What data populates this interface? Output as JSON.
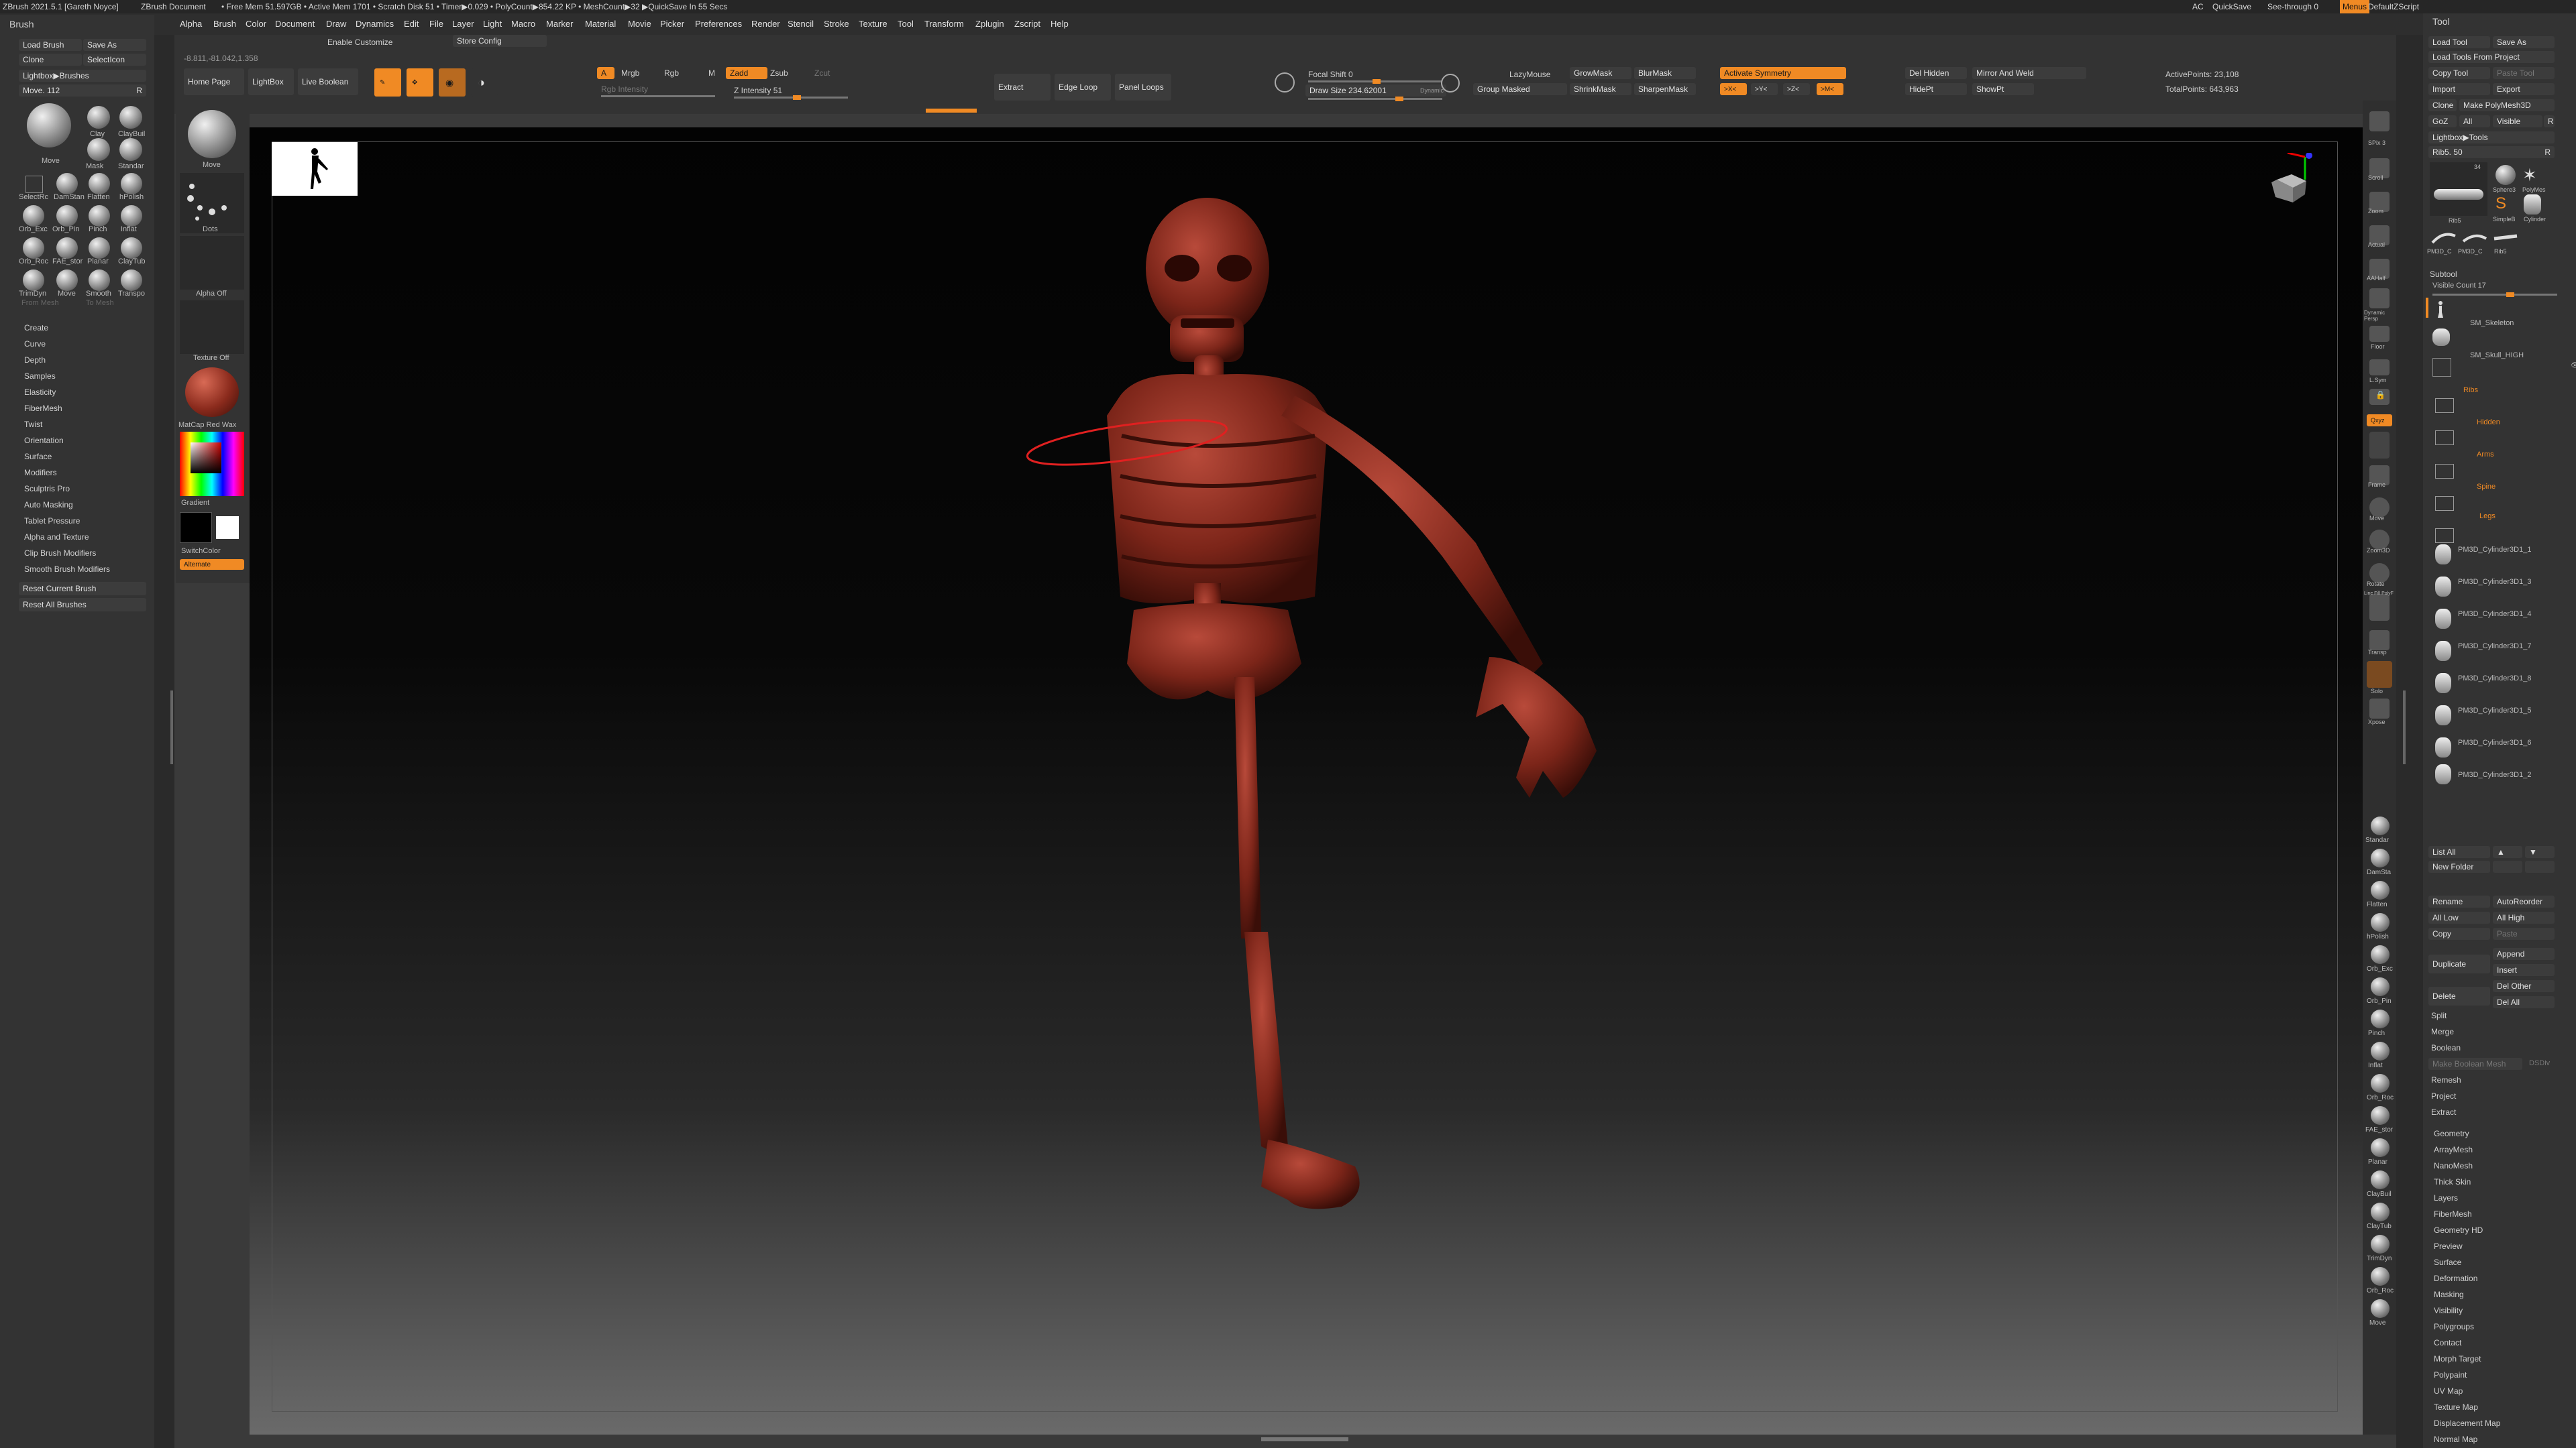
{
  "titlebar": {
    "items": [
      "ZBrush 2021.5.1 [Gareth Noyce]",
      "ZBrush Document",
      "• Free Mem 51.597GB • Active Mem 1701 • Scratch Disk 51 • Timer▶0.029 • PolyCount▶854.22 KP • MeshCount▶32 ▶QuickSave In 55 Secs"
    ],
    "right": [
      "AC",
      "QuickSave",
      "See-through 0",
      "Menus",
      "DefaultZScript"
    ]
  },
  "menu": [
    "Alpha",
    "Brush",
    "Color",
    "Document",
    "Draw",
    "Dynamics",
    "Edit",
    "File",
    "Layer",
    "Light",
    "Macro",
    "Marker",
    "Material",
    "Movie",
    "Picker",
    "Preferences",
    "Render",
    "Stencil",
    "Stroke",
    "Texture",
    "Tool",
    "Transform",
    "Zplugin",
    "Zscript",
    "Help"
  ],
  "toolbar": {
    "coords": "-8.811,-81.042,1.358",
    "enable_customize": "Enable Customize",
    "store_config": "Store Config",
    "home_page": "Home Page",
    "lightbox": "LightBox",
    "live_boolean": "Live Boolean",
    "edit": "Edit",
    "draw": "Draw",
    "a": "A",
    "mrgb": "Mrgb",
    "rgb": "Rgb",
    "m": "M",
    "zadd": "Zadd",
    "zsub": "Zsub",
    "zcut": "Zcut",
    "rgb_intensity": "Rgb Intensity",
    "z_intensity": "Z Intensity 51",
    "extract": "Extract",
    "edge_loop": "Edge Loop",
    "panel_loops": "Panel Loops",
    "focal_shift": "Focal Shift 0",
    "draw_size": "Draw Size 234.62001",
    "dynamic": "Dynamic",
    "lazymouse": "LazyMouse",
    "growmask": "GrowMask",
    "blurmask": "BlurMask",
    "group_masked": "Group Masked",
    "shrinkmask": "ShrinkMask",
    "sharpenmask": "SharpenMask",
    "activate_symmetry": "Activate Symmetry",
    "sym_x": ">X<",
    "sym_y": ">Y<",
    "sym_z": ">Z<",
    "sym_m": ">M<",
    "del_hidden": "Del Hidden",
    "mirror_weld": "Mirror And Weld",
    "hidepi": "HidePt",
    "showpt": "ShowPt",
    "active_points": "ActivePoints: 23,108",
    "total_points": "TotalPoints: 643,963"
  },
  "left": {
    "header": "Brush",
    "load_brush": "Load Brush",
    "save_as": "Save As",
    "clone": "Clone",
    "selecticon": "SelectIcon",
    "lightbox_brushes": "Lightbox▶Brushes",
    "move_value": "Move. 112",
    "move_r": "R",
    "brushes": [
      "Move",
      "Clay",
      "ClayBuil",
      "Mask",
      "Standar",
      "SelectRc",
      "DamStan",
      "Flatten",
      "hPolish",
      "Orb_Exc",
      "Orb_Pin",
      "Pinch",
      "Inflat",
      "Orb_Roc",
      "FAE_stor",
      "Planar",
      "ClayTub",
      "TrimDyn",
      "Move",
      "Smooth",
      "Transpo"
    ],
    "from_mesh": "From Mesh",
    "to_mesh": "To Mesh",
    "sections": [
      "Create",
      "Curve",
      "Depth",
      "Samples",
      "Elasticity",
      "FiberMesh",
      "Twist",
      "Orientation",
      "Surface",
      "Modifiers",
      "Sculptris Pro",
      "Auto Masking",
      "Tablet Pressure",
      "Alpha and Texture",
      "Clip Brush Modifiers",
      "Smooth Brush Modifiers"
    ],
    "reset_current": "Reset Current Brush",
    "reset_all": "Reset All Brushes"
  },
  "brushcol": {
    "move": "Move",
    "dots": "Dots",
    "alpha_off": "Alpha Off",
    "texture_off": "Texture Off",
    "matcap": "MatCap Red Wax",
    "gradient": "Gradient",
    "switchcolor": "SwitchColor",
    "alternate": "Alternate"
  },
  "shelf": {
    "top": [
      "SPix 3",
      "Scroll",
      "Zoom",
      "Actual",
      "AAHalf",
      "Dynamic Persp",
      "Floor",
      "L.Sym",
      "Lock",
      "Qxyz",
      "",
      "Frame",
      "Move",
      "Zoom3D",
      "Rotate",
      "Line Fill PolyF",
      "Transp",
      "Solo",
      "Xpose"
    ],
    "brushes": [
      "Standar",
      "DamSta",
      "Flatten",
      "hPolish",
      "Orb_Exc",
      "Orb_Pin",
      "Pinch",
      "Inflat",
      "Orb_Roc",
      "FAE_stor",
      "Planar",
      "ClayBuil",
      "ClayTub",
      "TrimDyn",
      "Orb_Roc",
      "Move"
    ]
  },
  "right": {
    "header": "Tool",
    "load_tool": "Load Tool",
    "save_as": "Save As",
    "load_from_project": "Load Tools From Project",
    "copy_tool": "Copy Tool",
    "paste_tool": "Paste Tool",
    "import": "Import",
    "export": "Export",
    "clone": "Clone",
    "make_polymesh": "Make PolyMesh3D",
    "goz": "GoZ",
    "all": "All",
    "visible": "Visible",
    "r": "R",
    "lightbox_tools": "Lightbox▶Tools",
    "rib5_label": "Rib5. 50",
    "rib5_r": "R",
    "tool_count": "34",
    "tool_thumbs": [
      "Rib5",
      "Sphere3",
      "PolyMes",
      "SimpleB",
      "Cylinder",
      "PM3D_C",
      "PM3D_C",
      "Rib5"
    ],
    "subtool": "Subtool",
    "visible_count": "Visible Count 17",
    "subtools": [
      "",
      "SM_Skeleton",
      "SM_Skull_HIGH",
      "Ribs",
      "Hidden",
      "Arms",
      "Spine",
      "Legs",
      "PM3D_Cylinder3D1_1",
      "PM3D_Cylinder3D1_3",
      "PM3D_Cylinder3D1_4",
      "PM3D_Cylinder3D1_7",
      "PM3D_Cylinder3D1_8",
      "PM3D_Cylinder3D1_5",
      "PM3D_Cylinder3D1_6",
      "PM3D_Cylinder3D1_2"
    ],
    "list_all": "List All",
    "new_folder": "New Folder",
    "rename": "Rename",
    "autoreorder": "AutoReorder",
    "all_low": "All Low",
    "all_high": "All High",
    "copy": "Copy",
    "paste": "Paste",
    "duplicate": "Duplicate",
    "append": "Append",
    "insert": "Insert",
    "delete": "Delete",
    "del_other": "Del Other",
    "del_all": "Del All",
    "ops": [
      "Split",
      "Merge",
      "Boolean",
      "Make Boolean Mesh",
      "Remesh",
      "Project",
      "Extract"
    ],
    "dsdiv": "DSDiv",
    "sections": [
      "Geometry",
      "ArrayMesh",
      "NanoMesh",
      "Thick Skin",
      "Layers",
      "FiberMesh",
      "Geometry HD",
      "Preview",
      "Surface",
      "Deformation",
      "Masking",
      "Visibility",
      "Polygroups",
      "Contact",
      "Morph Target",
      "Polypaint",
      "UV Map",
      "Texture Map",
      "Displacement Map",
      "Normal Map"
    ]
  },
  "colors": {
    "accent": "#f08a24",
    "skeleton": "#8a2a20"
  }
}
